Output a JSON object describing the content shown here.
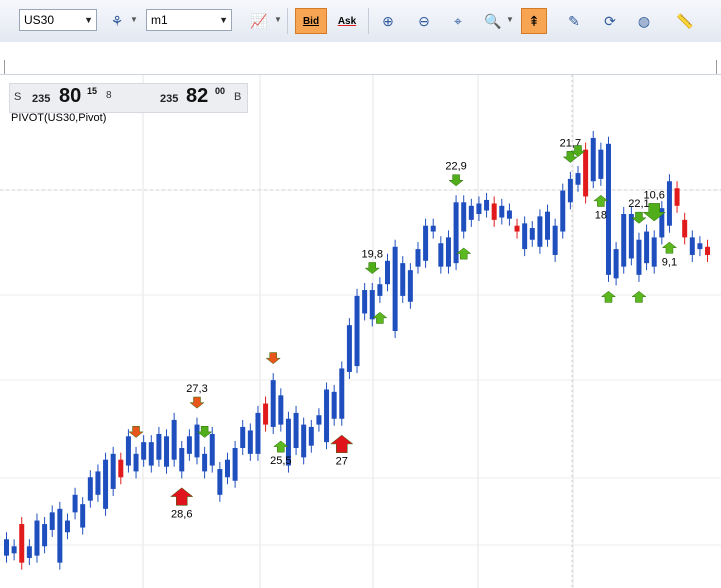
{
  "toolbar": {
    "symbol": "US30",
    "timeframe": "m1",
    "bid_label": "Bid",
    "ask_label": "Ask"
  },
  "quote": {
    "sell_label": "S",
    "sell_prefix": "235",
    "sell_big": "80",
    "sell_sup": "15",
    "spread": "8",
    "buy_prefix": "235",
    "buy_big": "82",
    "buy_sup": "00",
    "buy_label": "B"
  },
  "indicator_label": "PIVOT(US30,Pivot)",
  "chart_data": {
    "type": "candlestick",
    "colors": {
      "up": "#1f4fbf",
      "down": "#e11b1b",
      "arrow_up": "#5bb81e",
      "arrow_down_red": "#e8561c",
      "arrow_down_green": "#4fae1a"
    },
    "candles": [
      {
        "o": 8,
        "c": 22
      },
      {
        "o": 10,
        "c": 16
      },
      {
        "o": 35,
        "c": 2
      },
      {
        "o": 6,
        "c": 16
      },
      {
        "o": 8,
        "c": 38
      },
      {
        "o": 16,
        "c": 35
      },
      {
        "o": 30,
        "c": 45
      },
      {
        "o": 2,
        "c": 48
      },
      {
        "o": 28,
        "c": 38
      },
      {
        "o": 45,
        "c": 60
      },
      {
        "o": 32,
        "c": 52
      },
      {
        "o": 55,
        "c": 75
      },
      {
        "o": 60,
        "c": 80
      },
      {
        "o": 48,
        "c": 90
      },
      {
        "o": 65,
        "c": 95
      },
      {
        "o": 90,
        "c": 75
      },
      {
        "o": 85,
        "c": 110
      },
      {
        "o": 80,
        "c": 95
      },
      {
        "o": 90,
        "c": 105
      },
      {
        "o": 85,
        "c": 105
      },
      {
        "o": 90,
        "c": 112
      },
      {
        "o": 84,
        "c": 110
      },
      {
        "o": 90,
        "c": 124
      },
      {
        "o": 80,
        "c": 100
      },
      {
        "o": 95,
        "c": 110
      },
      {
        "o": 92,
        "c": 120
      },
      {
        "o": 80,
        "c": 95
      },
      {
        "o": 85,
        "c": 112
      },
      {
        "o": 60,
        "c": 82
      },
      {
        "o": 75,
        "c": 90
      },
      {
        "o": 72,
        "c": 100
      },
      {
        "o": 100,
        "c": 118
      },
      {
        "o": 95,
        "c": 115
      },
      {
        "o": 95,
        "c": 130
      },
      {
        "o": 138,
        "c": 120
      },
      {
        "o": 118,
        "c": 158
      },
      {
        "o": 120,
        "c": 145
      },
      {
        "o": 85,
        "c": 125
      },
      {
        "o": 100,
        "c": 130
      },
      {
        "o": 92,
        "c": 120
      },
      {
        "o": 102,
        "c": 118
      },
      {
        "o": 120,
        "c": 128
      },
      {
        "o": 105,
        "c": 150
      },
      {
        "o": 125,
        "c": 148
      },
      {
        "o": 125,
        "c": 168
      },
      {
        "o": 165,
        "c": 205
      },
      {
        "o": 170,
        "c": 230
      },
      {
        "o": 215,
        "c": 235
      },
      {
        "o": 210,
        "c": 235
      },
      {
        "o": 230,
        "c": 240
      },
      {
        "o": 240,
        "c": 260
      },
      {
        "o": 200,
        "c": 272
      },
      {
        "o": 230,
        "c": 258
      },
      {
        "o": 225,
        "c": 252
      },
      {
        "o": 255,
        "c": 270
      },
      {
        "o": 260,
        "c": 290
      },
      {
        "o": 285,
        "c": 290
      },
      {
        "o": 255,
        "c": 275
      },
      {
        "o": 255,
        "c": 280
      },
      {
        "o": 258,
        "c": 310
      },
      {
        "o": 285,
        "c": 310
      },
      {
        "o": 295,
        "c": 307
      },
      {
        "o": 300,
        "c": 309
      },
      {
        "o": 303,
        "c": 312
      },
      {
        "o": 309,
        "c": 295
      },
      {
        "o": 297,
        "c": 307
      },
      {
        "o": 296,
        "c": 303
      },
      {
        "o": 290,
        "c": 285
      },
      {
        "o": 270,
        "c": 292
      },
      {
        "o": 278,
        "c": 288
      },
      {
        "o": 272,
        "c": 298
      },
      {
        "o": 278,
        "c": 302
      },
      {
        "o": 265,
        "c": 290
      },
      {
        "o": 285,
        "c": 320
      },
      {
        "o": 310,
        "c": 330
      },
      {
        "o": 325,
        "c": 335
      },
      {
        "o": 355,
        "c": 315
      },
      {
        "o": 328,
        "c": 365
      },
      {
        "o": 330,
        "c": 355
      },
      {
        "o": 248,
        "c": 360
      },
      {
        "o": 245,
        "c": 270
      },
      {
        "o": 255,
        "c": 300
      },
      {
        "o": 262,
        "c": 300
      },
      {
        "o": 248,
        "c": 278
      },
      {
        "o": 258,
        "c": 285
      },
      {
        "o": 255,
        "c": 280
      },
      {
        "o": 280,
        "c": 305
      },
      {
        "o": 290,
        "c": 328
      },
      {
        "o": 322,
        "c": 307
      },
      {
        "o": 295,
        "c": 280
      },
      {
        "o": 265,
        "c": 280
      },
      {
        "o": 270,
        "c": 275
      },
      {
        "o": 272,
        "c": 265
      }
    ],
    "pivots": [
      {
        "i": 17,
        "dir": "down",
        "color": "red",
        "label": ""
      },
      {
        "i": 23,
        "dir": "up",
        "color": "red",
        "label": "28,6"
      },
      {
        "i": 25,
        "dir": "down",
        "color": "red",
        "label": "27,3"
      },
      {
        "i": 26,
        "dir": "down",
        "color": "green",
        "label": ""
      },
      {
        "i": 35,
        "dir": "down",
        "color": "red",
        "label": ""
      },
      {
        "i": 36,
        "dir": "up",
        "color": "green",
        "label": "25,5"
      },
      {
        "i": 44,
        "dir": "up",
        "color": "red",
        "label": "27"
      },
      {
        "i": 48,
        "dir": "down",
        "color": "green",
        "label": "19,8"
      },
      {
        "i": 49,
        "dir": "up",
        "color": "green",
        "label": ""
      },
      {
        "i": 59,
        "dir": "down",
        "color": "green",
        "label": "22,9"
      },
      {
        "i": 60,
        "dir": "up",
        "color": "green",
        "label": ""
      },
      {
        "i": 74,
        "dir": "down",
        "color": "green",
        "label": "21,7"
      },
      {
        "i": 75,
        "dir": "down",
        "color": "green",
        "label": ""
      },
      {
        "i": 78,
        "dir": "up",
        "color": "green",
        "label": "18"
      },
      {
        "i": 79,
        "dir": "up",
        "color": "green",
        "label": ""
      },
      {
        "i": 83,
        "dir": "down",
        "color": "green",
        "label": "22,1"
      },
      {
        "i": 83,
        "dir": "up",
        "color": "green",
        "label": ""
      },
      {
        "i": 85,
        "dir": "down",
        "color": "green",
        "label": "10,6"
      },
      {
        "i": 87,
        "dir": "up",
        "color": "green",
        "label": "9,1"
      }
    ]
  }
}
